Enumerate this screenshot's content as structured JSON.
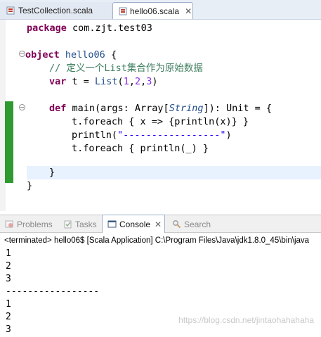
{
  "editor_tabs": [
    {
      "label": "TestCollection.scala",
      "active": false
    },
    {
      "label": "hello06.scala",
      "active": true,
      "close": "✕"
    }
  ],
  "code": {
    "line1": {
      "kw": "package",
      "rest": " com.zjt.test03"
    },
    "line2": {
      "kw": "object",
      "name": " hello06",
      "rest": " {"
    },
    "line3": {
      "comment": "// 定义一个List集合作为原始数据"
    },
    "line4": {
      "kw": "var",
      "mid": " t = ",
      "fn": "List",
      "p1": "(",
      "n1": "1",
      "c1": ",",
      "n2": "2",
      "c2": ",",
      "n3": "3",
      "p2": ")"
    },
    "line5": {
      "kw": "def",
      "sig": " main(args: Array[",
      "type": "String",
      "rest": "]): Unit = {"
    },
    "line6": {
      "text": "t.foreach { x => {println(x)} }"
    },
    "line7": {
      "pre": "println(",
      "str": "\"-----------------\"",
      "post": ")"
    },
    "line8": {
      "text": "t.foreach { println(_) }"
    },
    "line9": {
      "text": "}"
    },
    "line10": {
      "text": "}"
    }
  },
  "view_tabs": [
    {
      "label": "Problems",
      "icon": "problems-icon",
      "active": false
    },
    {
      "label": "Tasks",
      "icon": "tasks-icon",
      "active": false
    },
    {
      "label": "Console",
      "icon": "console-icon",
      "active": true,
      "close": "✕"
    },
    {
      "label": "Search",
      "icon": "search-icon",
      "active": false
    }
  ],
  "console": {
    "status": "<terminated> hello06$ [Scala Application] C:\\Program Files\\Java\\jdk1.8.0_45\\bin\\java",
    "output": [
      "1",
      "2",
      "3",
      "-----------------",
      "1",
      "2",
      "3"
    ]
  },
  "watermark": "https://blog.csdn.net/jintaohahahaha",
  "colors": {
    "keyword": "#7f0055",
    "comment": "#3f7f5f",
    "string": "#2a00ff",
    "number": "#8a2be2",
    "change_bar": "#2f9a2f"
  }
}
